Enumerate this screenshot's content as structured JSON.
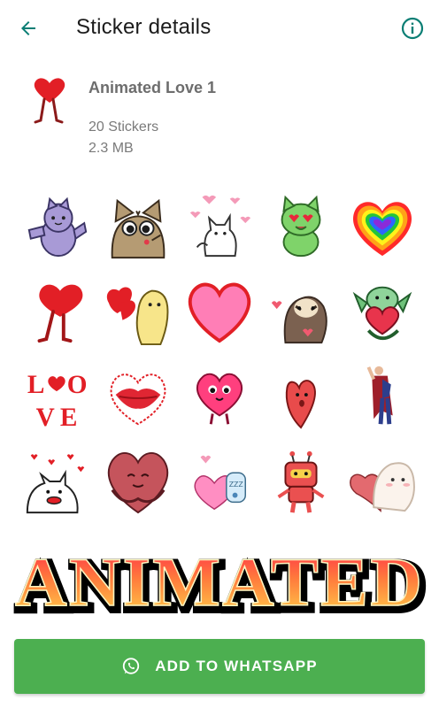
{
  "appbar": {
    "title": "Sticker details",
    "accent_color": "#0a7e74"
  },
  "pack": {
    "name": "Animated Love 1",
    "sticker_count": "20 Stickers",
    "size": "2.3 MB"
  },
  "stickers": [
    {
      "name": "purple-cat"
    },
    {
      "name": "tabby-cat-kiss"
    },
    {
      "name": "white-cat-hearts"
    },
    {
      "name": "green-cat-heart-eyes"
    },
    {
      "name": "rainbow-heart"
    },
    {
      "name": "walking-heart"
    },
    {
      "name": "yellow-blob-hearts"
    },
    {
      "name": "pink-heart"
    },
    {
      "name": "sloth-heart"
    },
    {
      "name": "dragon-heart"
    },
    {
      "name": "love-letters"
    },
    {
      "name": "kiss-lips"
    },
    {
      "name": "pink-heart-character"
    },
    {
      "name": "small-red-heart"
    },
    {
      "name": "hero-cape"
    },
    {
      "name": "cat-hearts-rain"
    },
    {
      "name": "hugging-heart"
    },
    {
      "name": "pink-hearts-jar"
    },
    {
      "name": "red-robot"
    },
    {
      "name": "ghost-heart"
    }
  ],
  "banner": {
    "text": "ANIMATED"
  },
  "cta": {
    "label": "ADD TO WHATSAPP",
    "color": "#4caf50"
  }
}
